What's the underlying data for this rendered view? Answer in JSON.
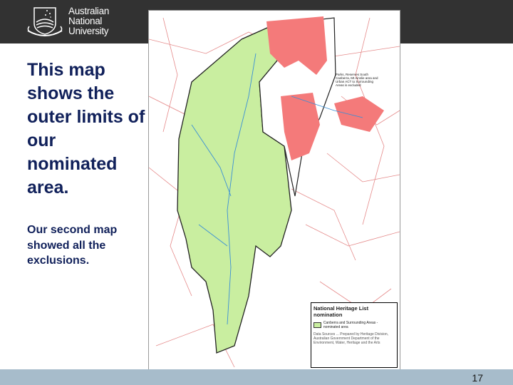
{
  "header": {
    "logo_lines": [
      "Australian",
      "National",
      "University"
    ]
  },
  "slide": {
    "title": "This map shows the outer limits of our nominated area.",
    "subtitle": "Our second map showed all the exclusions."
  },
  "map": {
    "note": "Parks, Reserves South Canberra, Mt Ainslie area and Urban ACT to Surrounding Areas is excluded",
    "legend_title": "National Heritage List nomination",
    "legend_entry": "Canberra and Surrounding Areas - nominated area",
    "legend_sources": "Data Sources ... Prepared by Heritage Division, Australian Government Department of the Environment, Water, Heritage and the Arts",
    "colors": {
      "nominated": "#c9eea0",
      "urban": "#f47a7a",
      "roads": "#e58a8a",
      "rivers": "#3a8fd6"
    }
  },
  "footer": {
    "page_number": "17"
  }
}
